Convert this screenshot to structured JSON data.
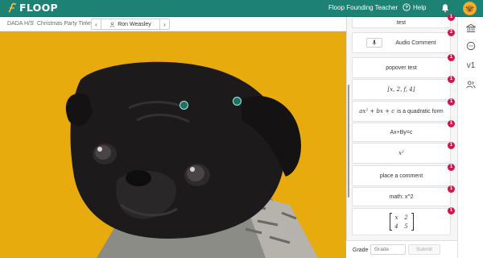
{
  "header": {
    "logo_text": "FLOOP",
    "teacher_name": "Floop Founding Teacher",
    "help_label": "Help",
    "icons": [
      "floop-logo-icon",
      "help-circle-icon",
      "bell-icon",
      "user-avatar"
    ]
  },
  "breadcrumb": {
    "course": "DADA H/S",
    "assignment": "Christmas Party Time",
    "separator": "/"
  },
  "student_nav": {
    "student_name": "Ron Weasley",
    "prev_icon": "chevron-left-icon",
    "next_icon": "chevron-right-icon"
  },
  "comments": [
    {
      "label": "test",
      "badge": "1"
    },
    {
      "label": "Audio Comment",
      "badge": "2"
    },
    {
      "label": "popover test",
      "badge": "1"
    },
    {
      "label": "[x, 2, f, 4]",
      "badge": "1"
    },
    {
      "math": "ax² + bx + c",
      "label": "is a quadratic form",
      "badge": "1"
    },
    {
      "label": "Ax+By=c",
      "badge": "1"
    },
    {
      "label": "x²",
      "badge": "1"
    },
    {
      "label": "place a comment",
      "badge": "1"
    },
    {
      "label": "math: x^2",
      "badge": "1"
    },
    {
      "matrix": [
        "x",
        "2",
        "4",
        "5"
      ],
      "badge": "1"
    }
  ],
  "grade": {
    "label": "Grade :",
    "placeholder": "Grade",
    "submit_label": "Submit"
  },
  "rail": {
    "version_label": "v1",
    "icons": [
      "bank-icon",
      "chat-bubble-icon",
      "version-icon",
      "people-icon"
    ]
  },
  "colors": {
    "brand": "#1d8274",
    "badge": "#d0164a",
    "image_background": "#e8ab0d"
  }
}
